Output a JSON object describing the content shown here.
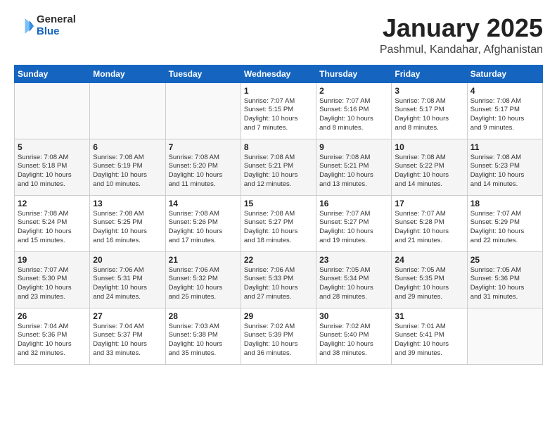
{
  "header": {
    "logo_general": "General",
    "logo_blue": "Blue",
    "month_title": "January 2025",
    "location": "Pashmul, Kandahar, Afghanistan"
  },
  "weekdays": [
    "Sunday",
    "Monday",
    "Tuesday",
    "Wednesday",
    "Thursday",
    "Friday",
    "Saturday"
  ],
  "weeks": [
    [
      {
        "day": "",
        "info": ""
      },
      {
        "day": "",
        "info": ""
      },
      {
        "day": "",
        "info": ""
      },
      {
        "day": "1",
        "info": "Sunrise: 7:07 AM\nSunset: 5:15 PM\nDaylight: 10 hours\nand 7 minutes."
      },
      {
        "day": "2",
        "info": "Sunrise: 7:07 AM\nSunset: 5:16 PM\nDaylight: 10 hours\nand 8 minutes."
      },
      {
        "day": "3",
        "info": "Sunrise: 7:08 AM\nSunset: 5:17 PM\nDaylight: 10 hours\nand 8 minutes."
      },
      {
        "day": "4",
        "info": "Sunrise: 7:08 AM\nSunset: 5:17 PM\nDaylight: 10 hours\nand 9 minutes."
      }
    ],
    [
      {
        "day": "5",
        "info": "Sunrise: 7:08 AM\nSunset: 5:18 PM\nDaylight: 10 hours\nand 10 minutes."
      },
      {
        "day": "6",
        "info": "Sunrise: 7:08 AM\nSunset: 5:19 PM\nDaylight: 10 hours\nand 10 minutes."
      },
      {
        "day": "7",
        "info": "Sunrise: 7:08 AM\nSunset: 5:20 PM\nDaylight: 10 hours\nand 11 minutes."
      },
      {
        "day": "8",
        "info": "Sunrise: 7:08 AM\nSunset: 5:21 PM\nDaylight: 10 hours\nand 12 minutes."
      },
      {
        "day": "9",
        "info": "Sunrise: 7:08 AM\nSunset: 5:21 PM\nDaylight: 10 hours\nand 13 minutes."
      },
      {
        "day": "10",
        "info": "Sunrise: 7:08 AM\nSunset: 5:22 PM\nDaylight: 10 hours\nand 14 minutes."
      },
      {
        "day": "11",
        "info": "Sunrise: 7:08 AM\nSunset: 5:23 PM\nDaylight: 10 hours\nand 14 minutes."
      }
    ],
    [
      {
        "day": "12",
        "info": "Sunrise: 7:08 AM\nSunset: 5:24 PM\nDaylight: 10 hours\nand 15 minutes."
      },
      {
        "day": "13",
        "info": "Sunrise: 7:08 AM\nSunset: 5:25 PM\nDaylight: 10 hours\nand 16 minutes."
      },
      {
        "day": "14",
        "info": "Sunrise: 7:08 AM\nSunset: 5:26 PM\nDaylight: 10 hours\nand 17 minutes."
      },
      {
        "day": "15",
        "info": "Sunrise: 7:08 AM\nSunset: 5:27 PM\nDaylight: 10 hours\nand 18 minutes."
      },
      {
        "day": "16",
        "info": "Sunrise: 7:07 AM\nSunset: 5:27 PM\nDaylight: 10 hours\nand 19 minutes."
      },
      {
        "day": "17",
        "info": "Sunrise: 7:07 AM\nSunset: 5:28 PM\nDaylight: 10 hours\nand 21 minutes."
      },
      {
        "day": "18",
        "info": "Sunrise: 7:07 AM\nSunset: 5:29 PM\nDaylight: 10 hours\nand 22 minutes."
      }
    ],
    [
      {
        "day": "19",
        "info": "Sunrise: 7:07 AM\nSunset: 5:30 PM\nDaylight: 10 hours\nand 23 minutes."
      },
      {
        "day": "20",
        "info": "Sunrise: 7:06 AM\nSunset: 5:31 PM\nDaylight: 10 hours\nand 24 minutes."
      },
      {
        "day": "21",
        "info": "Sunrise: 7:06 AM\nSunset: 5:32 PM\nDaylight: 10 hours\nand 25 minutes."
      },
      {
        "day": "22",
        "info": "Sunrise: 7:06 AM\nSunset: 5:33 PM\nDaylight: 10 hours\nand 27 minutes."
      },
      {
        "day": "23",
        "info": "Sunrise: 7:05 AM\nSunset: 5:34 PM\nDaylight: 10 hours\nand 28 minutes."
      },
      {
        "day": "24",
        "info": "Sunrise: 7:05 AM\nSunset: 5:35 PM\nDaylight: 10 hours\nand 29 minutes."
      },
      {
        "day": "25",
        "info": "Sunrise: 7:05 AM\nSunset: 5:36 PM\nDaylight: 10 hours\nand 31 minutes."
      }
    ],
    [
      {
        "day": "26",
        "info": "Sunrise: 7:04 AM\nSunset: 5:36 PM\nDaylight: 10 hours\nand 32 minutes."
      },
      {
        "day": "27",
        "info": "Sunrise: 7:04 AM\nSunset: 5:37 PM\nDaylight: 10 hours\nand 33 minutes."
      },
      {
        "day": "28",
        "info": "Sunrise: 7:03 AM\nSunset: 5:38 PM\nDaylight: 10 hours\nand 35 minutes."
      },
      {
        "day": "29",
        "info": "Sunrise: 7:02 AM\nSunset: 5:39 PM\nDaylight: 10 hours\nand 36 minutes."
      },
      {
        "day": "30",
        "info": "Sunrise: 7:02 AM\nSunset: 5:40 PM\nDaylight: 10 hours\nand 38 minutes."
      },
      {
        "day": "31",
        "info": "Sunrise: 7:01 AM\nSunset: 5:41 PM\nDaylight: 10 hours\nand 39 minutes."
      },
      {
        "day": "",
        "info": ""
      }
    ]
  ]
}
